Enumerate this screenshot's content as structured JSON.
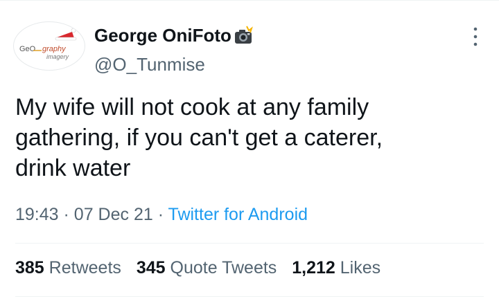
{
  "tweet": {
    "display_name": "George OniFoto",
    "handle": "@O_Tunmise",
    "text": "My wife will not cook at any family\ngathering, if you can't get a caterer,\ndrink water",
    "time": "19:43",
    "date": "07 Dec 21",
    "source": "Twitter for Android",
    "avatar_logo_line1": "GeO",
    "avatar_logo_line1b": "graphy",
    "avatar_logo_line2": "imagery"
  },
  "stats": {
    "retweets_count": "385",
    "retweets_label": "Retweets",
    "quotes_count": "345",
    "quotes_label": "Quote Tweets",
    "likes_count": "1,212",
    "likes_label": "Likes"
  },
  "icons": {
    "camera": "camera-with-flash-icon",
    "more": "more-vertical-icon"
  },
  "colors": {
    "text": "#0f1419",
    "secondary": "#536471",
    "link": "#1d9bf0",
    "divider": "#eff3f4"
  }
}
